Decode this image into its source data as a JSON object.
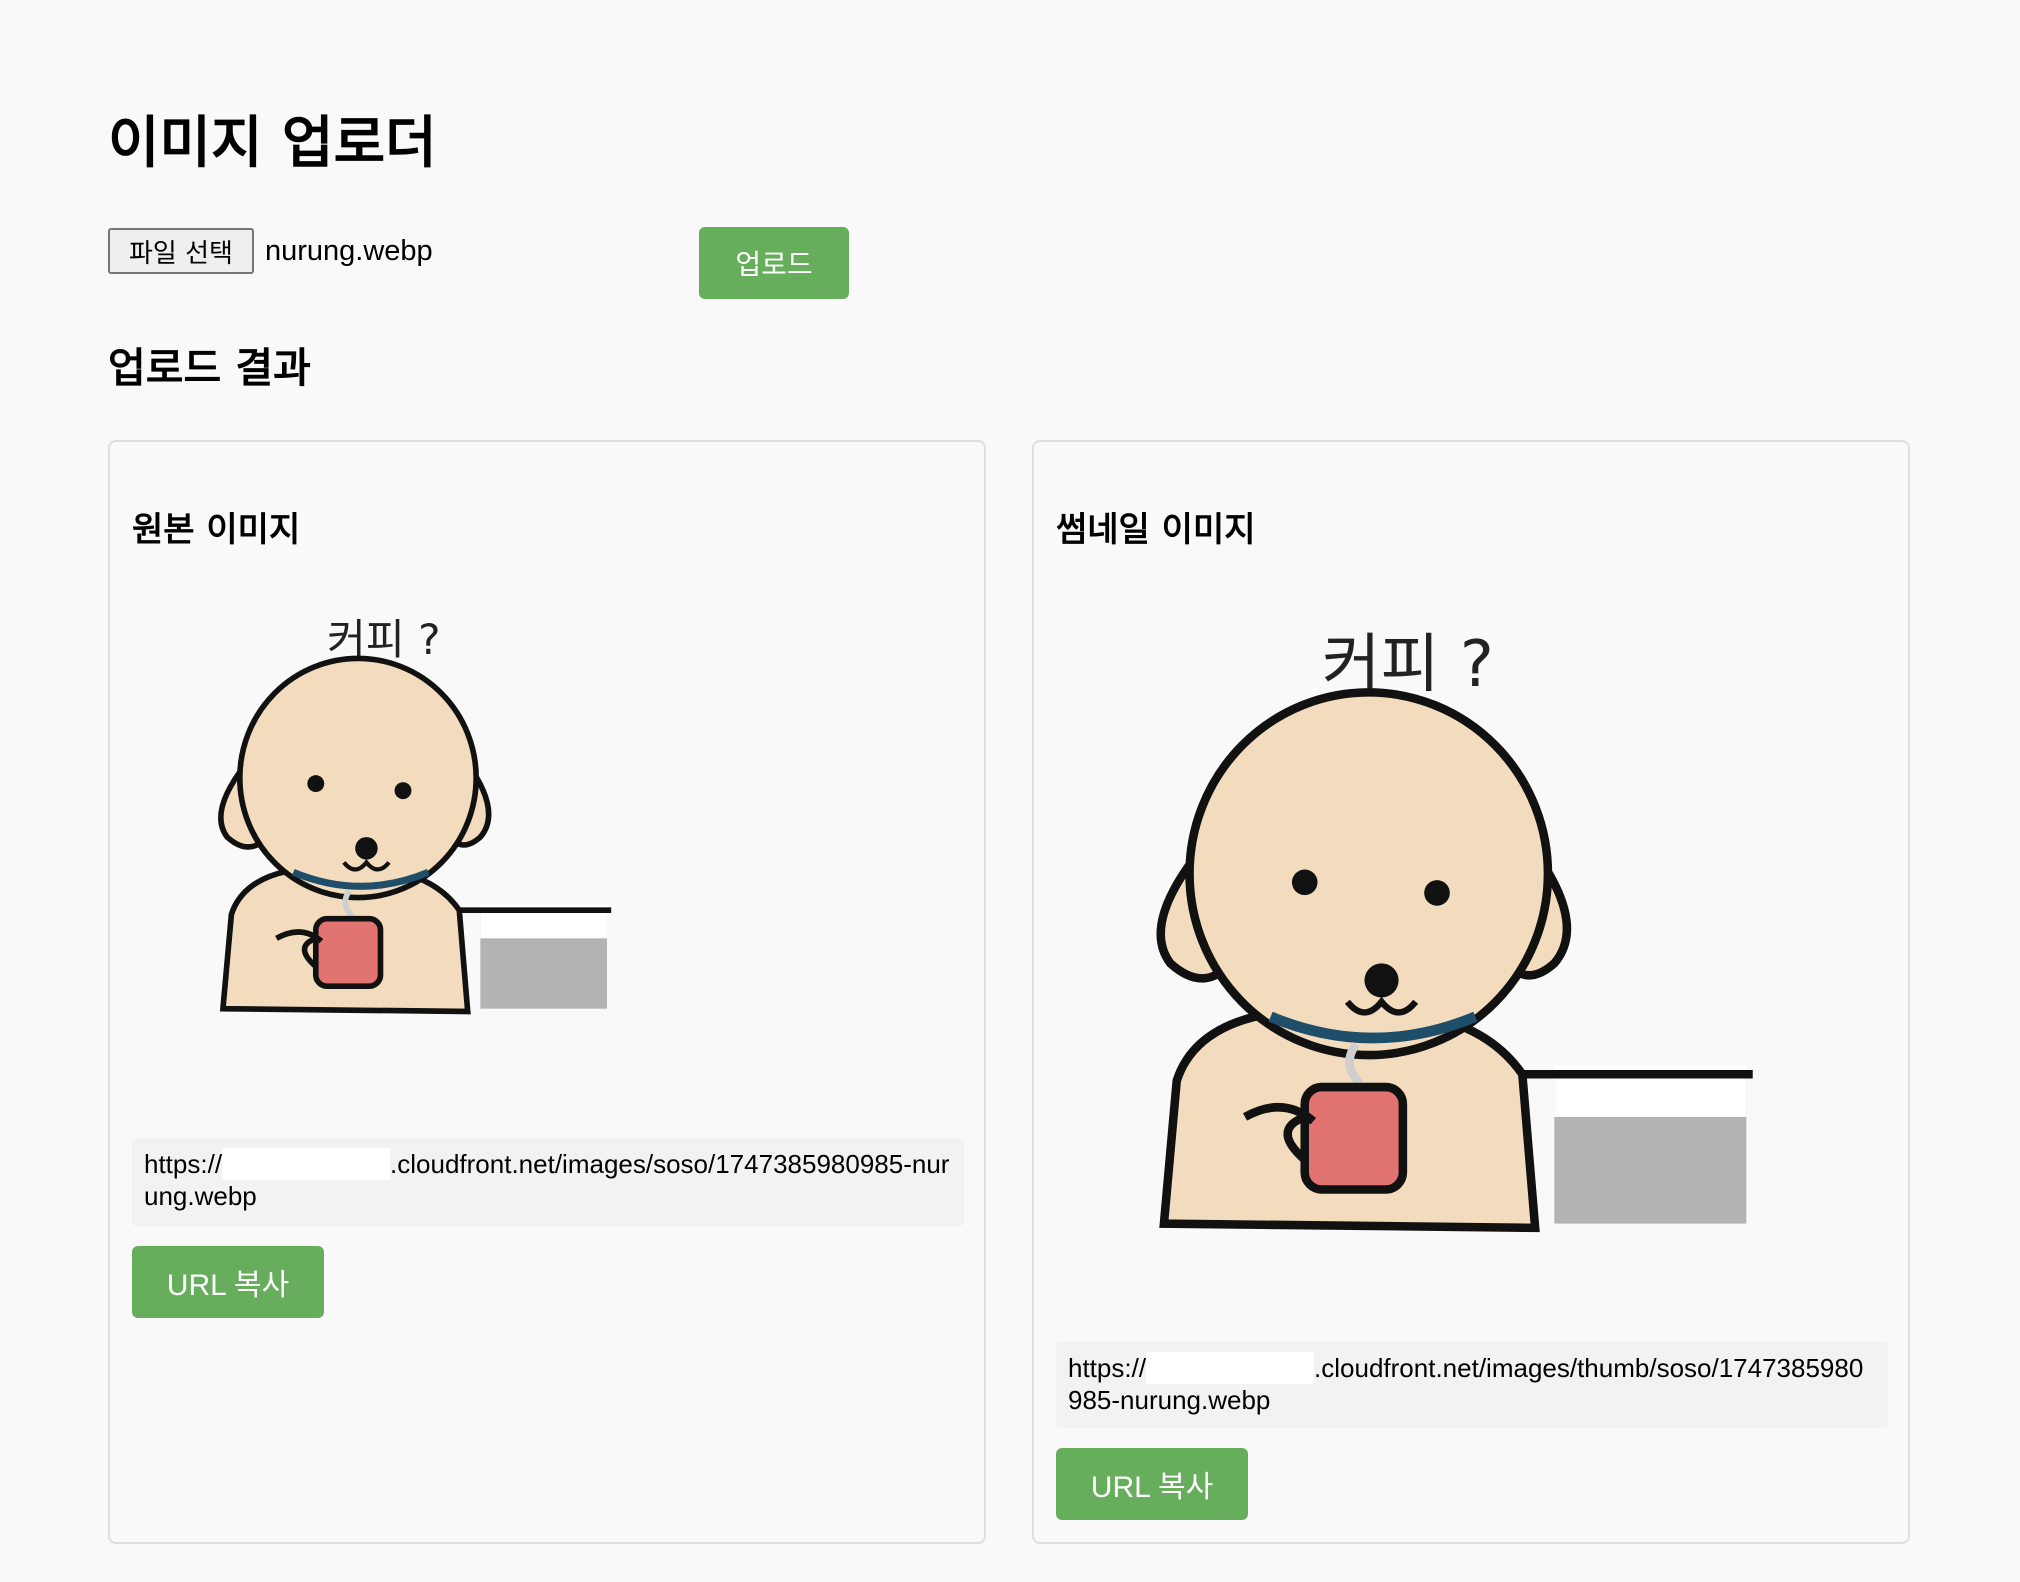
{
  "page": {
    "title": "이미지 업로더"
  },
  "upload_form": {
    "file_button_label": "파일 선택",
    "file_name": "nurung.webp",
    "upload_button_label": "업로드"
  },
  "results": {
    "section_title": "업로드 결과",
    "original": {
      "title": "원본 이미지",
      "image_caption_text": "커피 ?",
      "url_prefix": "https://",
      "url_suffix": ".cloudfront.net/images/soso/1747385980985-nurung.webp",
      "copy_button_label": "URL 복사"
    },
    "thumbnail": {
      "title": "썸네일 이미지",
      "image_caption_text": "커피 ?",
      "url_prefix": "https://",
      "url_suffix": ".cloudfront.net/images/thumb/soso/1747385980985-nurung.webp",
      "copy_button_label": "URL 복사"
    }
  },
  "colors": {
    "accent_green": "#66ae5c",
    "background": "#f9f9f9",
    "card_border": "#dedede",
    "url_box_bg": "#f2f2f2"
  }
}
